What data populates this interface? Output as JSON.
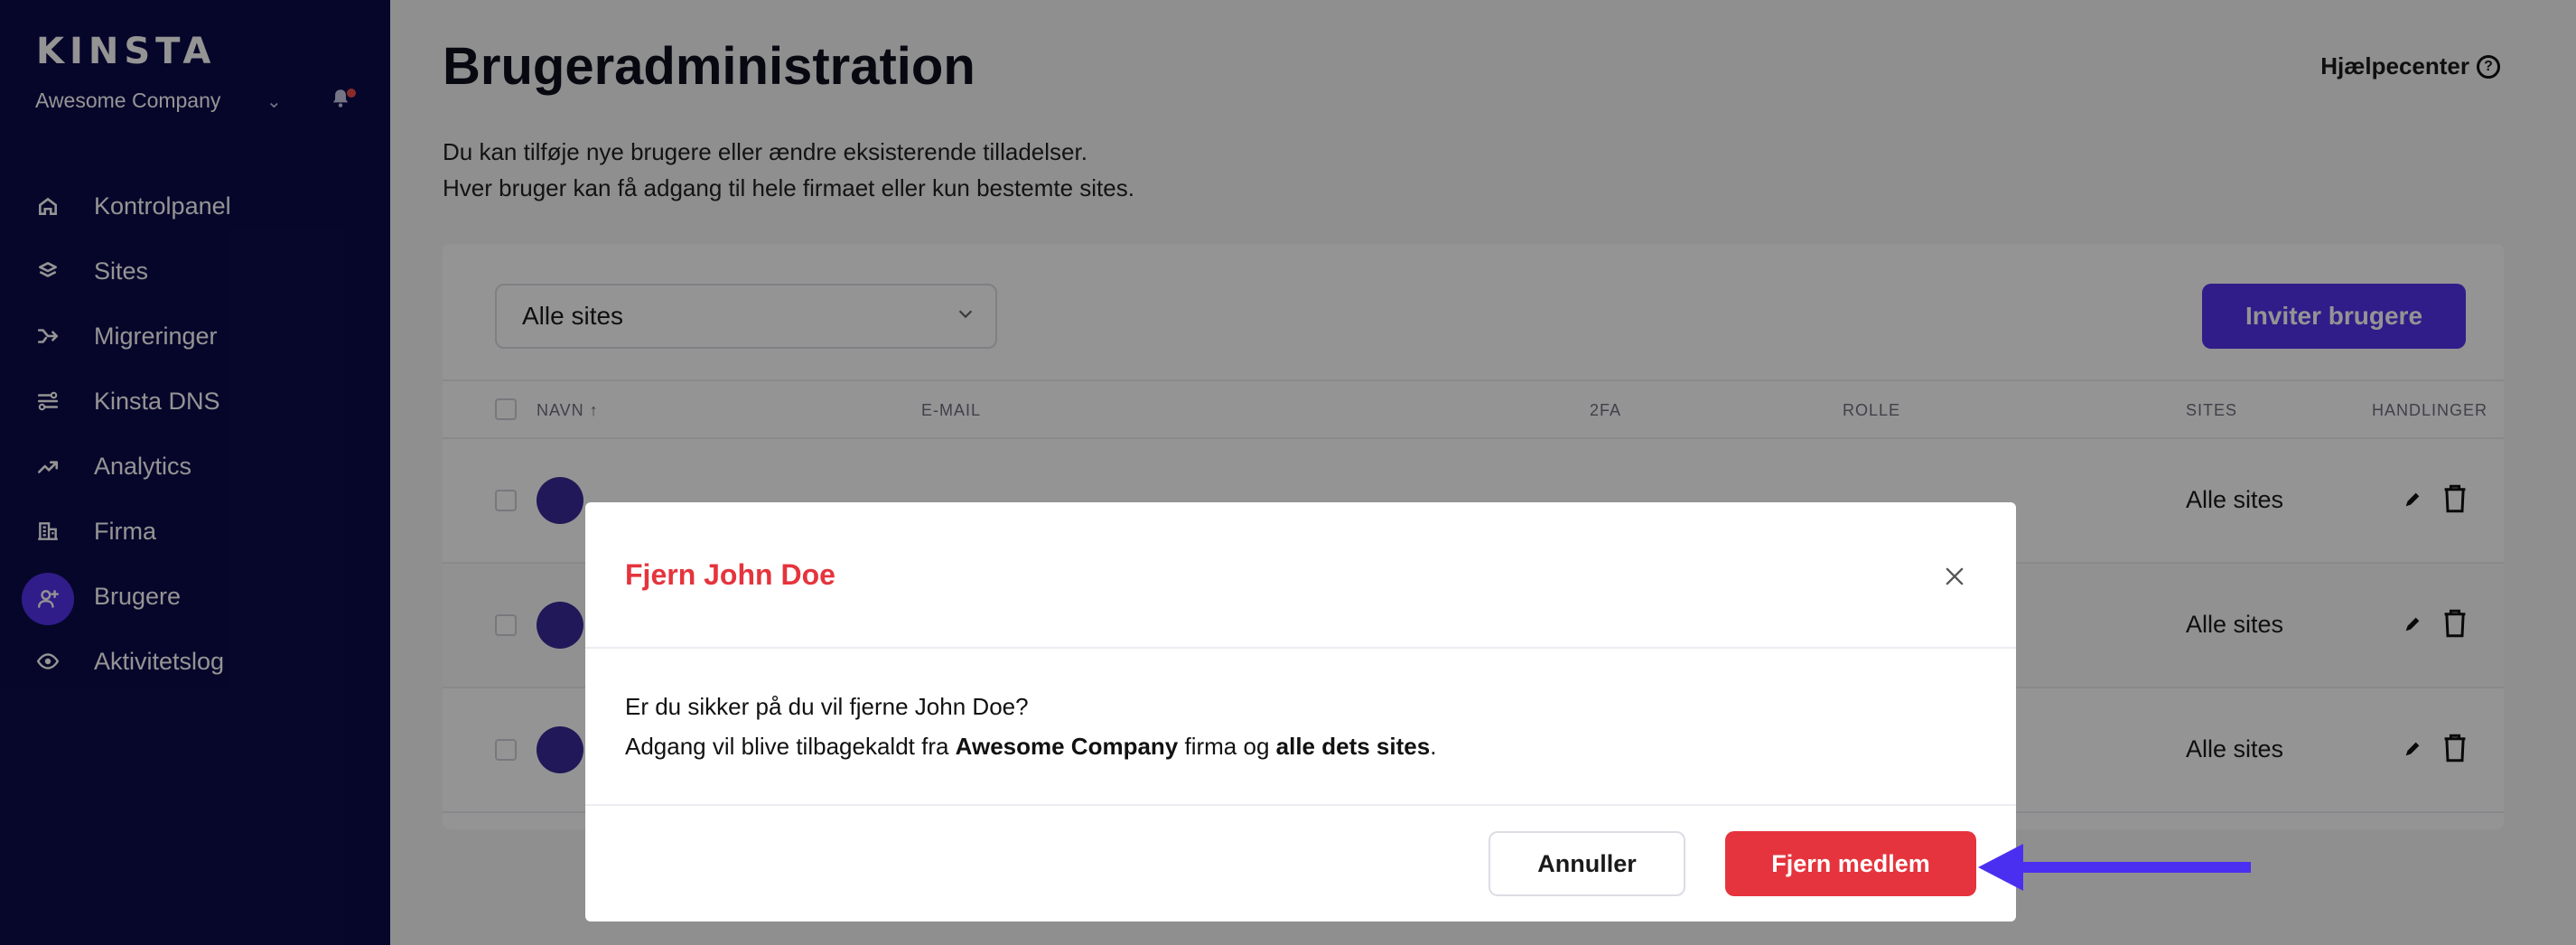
{
  "sidebar": {
    "logo": "KINSTA",
    "company": "Awesome Company",
    "items": [
      {
        "label": "Kontrolpanel",
        "icon": "home-icon"
      },
      {
        "label": "Sites",
        "icon": "layers-icon"
      },
      {
        "label": "Migreringer",
        "icon": "migrate-icon"
      },
      {
        "label": "Kinsta DNS",
        "icon": "dns-icon"
      },
      {
        "label": "Analytics",
        "icon": "trend-icon"
      },
      {
        "label": "Firma",
        "icon": "building-icon"
      },
      {
        "label": "Brugere",
        "icon": "add-user-icon",
        "active": true
      },
      {
        "label": "Aktivitetslog",
        "icon": "eye-icon"
      }
    ]
  },
  "header": {
    "title": "Brugeradministration",
    "help_label": "Hjælpecenter",
    "description_line1": "Du kan tilføje nye brugere eller ændre eksisterende tilladelser.",
    "description_line2": "Hver bruger kan få adgang til hele firmaet eller kun bestemte sites."
  },
  "toolbar": {
    "filter_value": "Alle sites",
    "invite_label": "Inviter brugere"
  },
  "table": {
    "headers": {
      "name": "NAVN ↑",
      "email": "E-MAIL",
      "twofa": "2FA",
      "role": "ROLLE",
      "sites": "SITES",
      "actions": "HANDLINGER"
    },
    "rows": [
      {
        "sites": "Alle sites"
      },
      {
        "sites": "Alle sites"
      },
      {
        "sites": "Alle sites"
      }
    ]
  },
  "modal": {
    "title": "Fjern John Doe",
    "line1": "Er du sikker på du vil fjerne John Doe?",
    "line2_prefix": "Adgang vil blive tilbagekaldt fra ",
    "line2_company": "Awesome Company",
    "line2_middle": " firma og ",
    "line2_sites": "alle dets sites",
    "line2_suffix": ".",
    "cancel_label": "Annuller",
    "remove_label": "Fjern medlem"
  },
  "colors": {
    "sidebar_bg": "#0c0c4a",
    "accent": "#5333ed",
    "danger": "#e5343d",
    "annotation_arrow": "#4b2ff0"
  }
}
